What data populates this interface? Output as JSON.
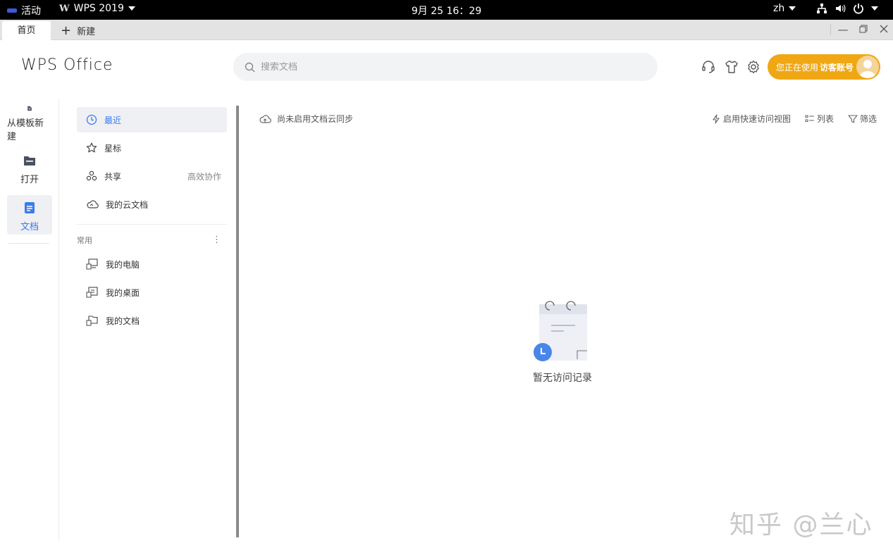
{
  "system_bar": {
    "activities": "活动",
    "app_name": "WPS 2019",
    "clock": "9月 25  16：29",
    "language": "zh"
  },
  "tabs": {
    "home": "首页",
    "new": "新建"
  },
  "header": {
    "logo": "WPS Office",
    "search_placeholder": "搜索文档",
    "account_prefix": "您正在使用",
    "account_name": "访客账号"
  },
  "leftnav": {
    "items": [
      {
        "label": "从模板新建",
        "icon": "template-new-icon",
        "active": false
      },
      {
        "label": "打开",
        "icon": "folder-icon",
        "active": false
      },
      {
        "label": "文档",
        "icon": "document-icon",
        "active": true
      }
    ]
  },
  "midpanel": {
    "items": [
      {
        "label": "最近",
        "icon": "clock-icon",
        "active": true
      },
      {
        "label": "星标",
        "icon": "star-icon"
      },
      {
        "label": "共享",
        "icon": "share-icon",
        "extra": "高效协作"
      },
      {
        "label": "我的云文档",
        "icon": "cloud-icon"
      }
    ],
    "section_label": "常用",
    "common": [
      {
        "label": "我的电脑",
        "icon": "computer-icon"
      },
      {
        "label": "我的桌面",
        "icon": "desktop-icon"
      },
      {
        "label": "我的文档",
        "icon": "my-documents-icon"
      }
    ]
  },
  "content": {
    "cloud_status": "尚未启用文档云同步",
    "toolbar": {
      "quick_access": "启用快速访问视图",
      "list": "列表",
      "filter": "筛选"
    },
    "empty_text": "暂无访问记录"
  },
  "watermark": "知乎 @兰心",
  "colors": {
    "accent": "#3b7ce8",
    "account_bg": "#f0a714",
    "active_bg": "#eef0f4"
  }
}
